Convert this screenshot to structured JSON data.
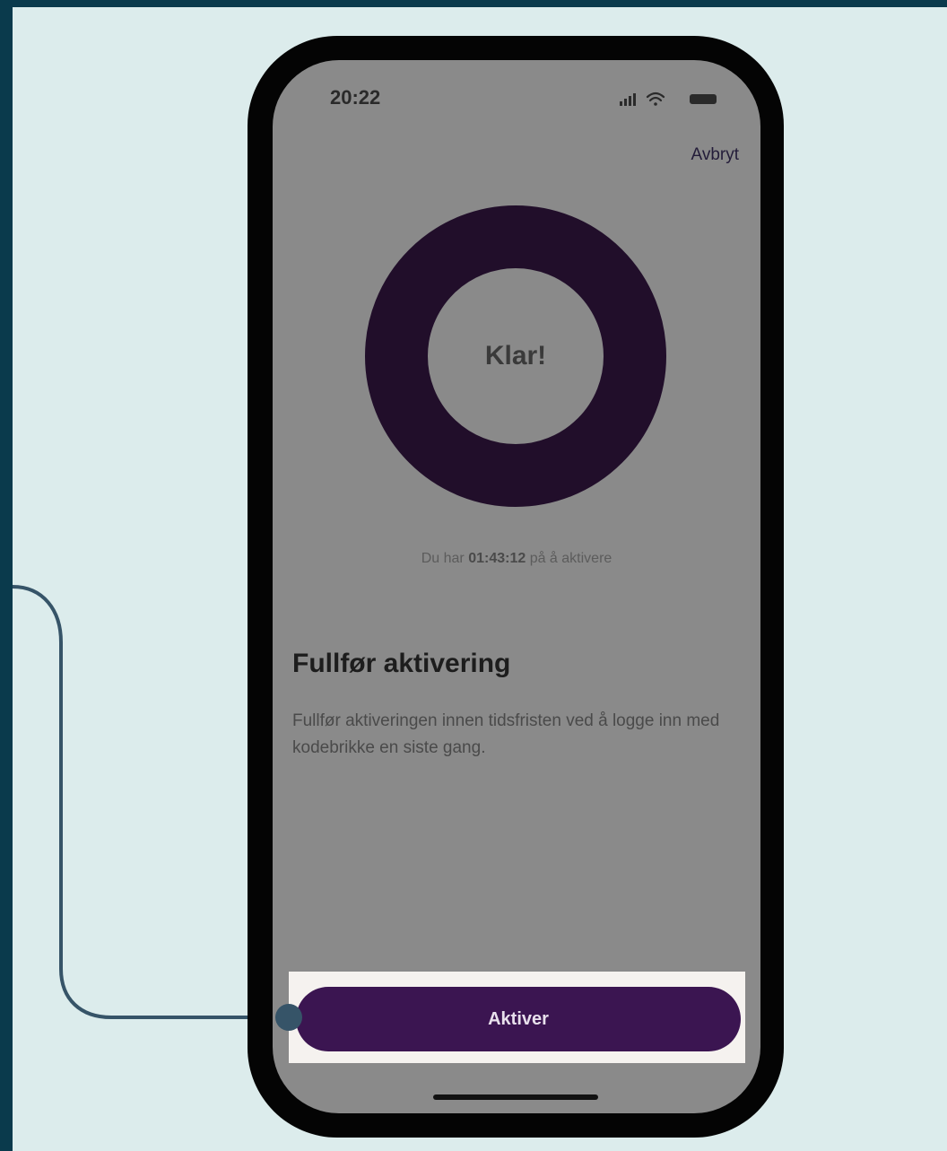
{
  "status_bar": {
    "time": "20:22",
    "icons": [
      "signal-icon",
      "wifi-icon",
      "battery-icon"
    ]
  },
  "header": {
    "cancel_label": "Avbryt"
  },
  "progress": {
    "label": "Klar!",
    "fraction_complete": 1.0
  },
  "countdown": {
    "prefix": "Du har",
    "time": "01:43:12",
    "suffix": "på å aktivere"
  },
  "main": {
    "title": "Fullfør aktivering",
    "description": "Fullfør aktiveringen innen tidsfristen ved å logge inn med kodebrikke en siste gang."
  },
  "actions": {
    "activate_label": "Aktiver"
  },
  "colors": {
    "page_background": "#0a3a4c",
    "canvas_background": "#dcecec",
    "ring": "#210e2a",
    "primary_button": "#3b1551",
    "connector_line": "#365468"
  }
}
